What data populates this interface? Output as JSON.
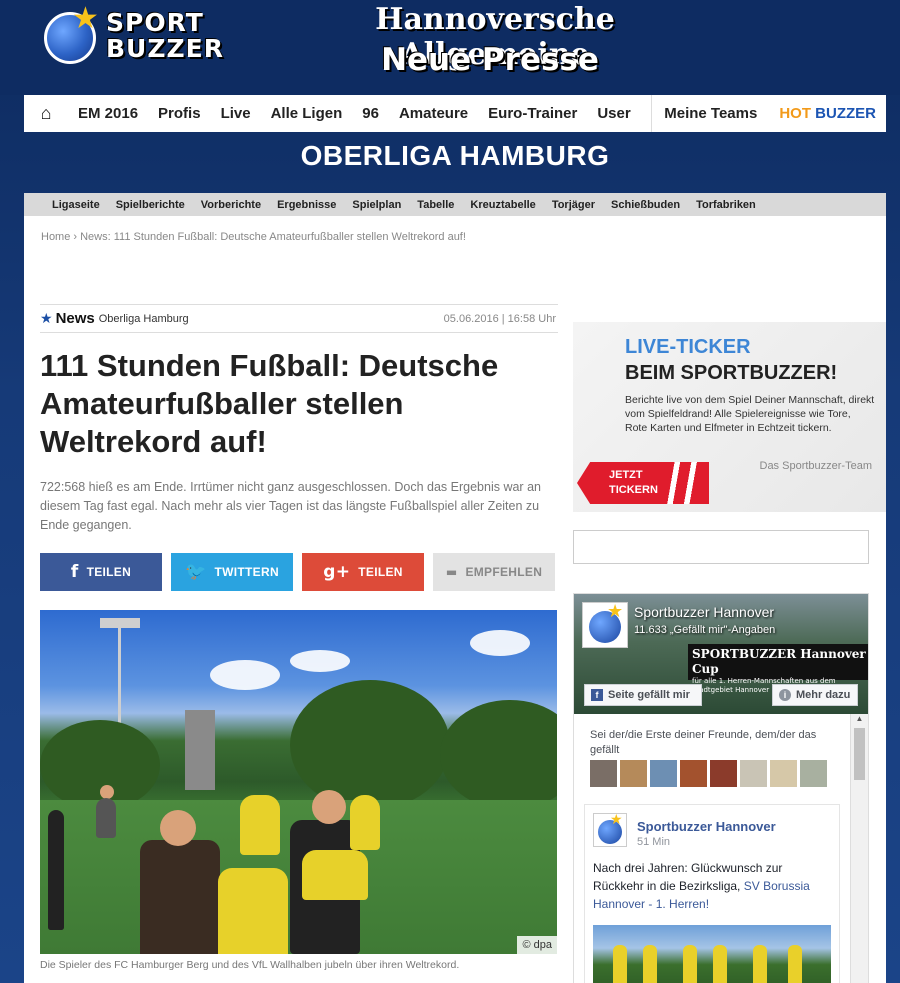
{
  "header": {
    "logo_line1": "SPORT",
    "logo_line2": "BUZZER",
    "paper_line1": "Hannoversche Allgemeine",
    "paper_line2": "Neue Presse"
  },
  "mainnav": {
    "items": [
      "EM 2016",
      "Profis",
      "Live",
      "Alle Ligen",
      "96",
      "Amateure",
      "Euro-Trainer",
      "User"
    ],
    "my_teams": "Meine Teams",
    "hot": "HOT",
    "buzzer": "BUZZER"
  },
  "league_title": "OBERLIGA HAMBURG",
  "subnav": [
    "Ligaseite",
    "Spielberichte",
    "Vorberichte",
    "Ergebnisse",
    "Spielplan",
    "Tabelle",
    "Kreuztabelle",
    "Torjäger",
    "Schießbuden",
    "Torfabriken"
  ],
  "breadcrumb": "Home › News: 111 Stunden Fußball: Deutsche Amateurfußballer stellen Weltrekord auf!",
  "article": {
    "section": "News",
    "category": "Oberliga Hamburg",
    "date": "05.06.2016 | 16:58 Uhr",
    "title": "111 Stunden Fußball: Deutsche Amateurfußballer stellen Weltrekord auf!",
    "lead": "722:568 hieß es am Ende. Irrtümer nicht ganz ausgeschlossen. Doch das Ergebnis war an diesem Tag fast egal. Nach mehr als vier Tagen ist das längste Fußballspiel aller Zeiten zu Ende gegangen.",
    "share": {
      "facebook": "TEILEN",
      "twitter": "TWITTERN",
      "gplus": "TEILEN",
      "recommend": "EMPFEHLEN"
    },
    "photo_credit": "© dpa",
    "caption": "Die Spieler des FC Hamburger Berg und des VfL Wallhalben jubeln über ihren Weltrekord."
  },
  "ticker": {
    "title1": "LIVE-TICKER",
    "title2": "BEIM SPORTBUZZER!",
    "text": "Berichte live von dem Spiel Deiner Mannschaft, direkt vom Spielfeldrand! Alle Spielereignisse wie Tore, Rote Karten und Elfmeter in Echtzeit tickern.",
    "signature": "Das Sportbuzzer-Team",
    "cta_line1": "JETZT",
    "cta_line2": "TICKERN"
  },
  "facebook": {
    "page_name": "Sportbuzzer Hannover",
    "likes": "11.633 „Gefällt mir\"-Angaben",
    "banner_line1": "SPORTBUZZER Hannover Cup",
    "banner_line2": "für alle 1. Herren-Mannschaften aus dem Stadtgebiet Hannover",
    "like_button": "Seite gefällt mir",
    "more_button": "Mehr dazu",
    "friends_text": "Sei der/die Erste deiner Freunde, dem/der das gefällt",
    "post_author": "Sportbuzzer Hannover",
    "post_time": "51 Min",
    "post_text": "Nach drei Jahren: Glückwunsch zur Rückkehr in die Bezirksliga,",
    "post_link": "SV Borussia Hannover - 1. Herren!"
  },
  "colors": {
    "brand_blue": "#0e2c62",
    "facebook": "#3b5998",
    "twitter": "#2aa3e0",
    "gplus": "#dd4b39",
    "ticker_red": "#e01c2c",
    "hot_orange": "#f29a1a"
  }
}
